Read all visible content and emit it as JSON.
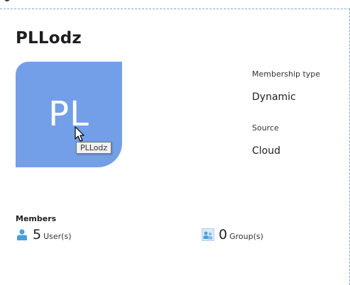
{
  "group": {
    "name": "PLLodz",
    "initials": "PL",
    "avatar_color": "#739fe8"
  },
  "tooltip": {
    "text": "PLLodz"
  },
  "properties": {
    "membership_type_label": "Membership type",
    "membership_type_value": "Dynamic",
    "source_label": "Source",
    "source_value": "Cloud"
  },
  "members": {
    "heading": "Members",
    "users": {
      "count": "5",
      "unit": "User(s)",
      "icon": "user-icon"
    },
    "groups": {
      "count": "0",
      "unit": "Group(s)",
      "icon": "group-icon"
    }
  },
  "colors": {
    "accent_dashed_border": "#7da8d6",
    "icon_blue": "#4a9fd8"
  }
}
